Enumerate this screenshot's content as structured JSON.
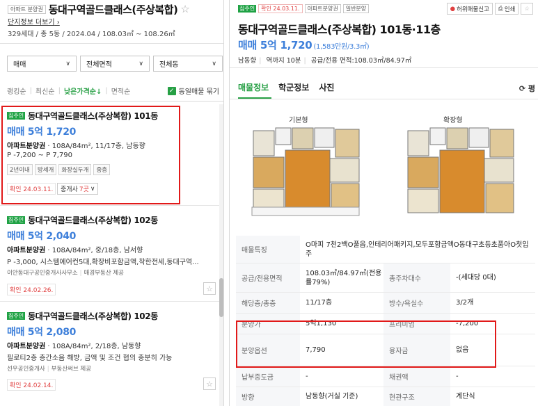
{
  "left": {
    "complex_tag": "아파트 분양권",
    "complex_name": "동대구역골드클래스(주상복합)",
    "more_info": "단지정보 더보기",
    "summary": "329세대 / 총 5동 / 2024.04 / 108.03㎡ ~ 108.26㎡",
    "filters": [
      "매매",
      "전체면적",
      "전체동"
    ],
    "sort": {
      "items": [
        "랭킹순",
        "최신순",
        "낮은가격순↓",
        "면적순"
      ],
      "active_index": 2,
      "same_listing": "동일매물 묶기"
    },
    "listings": [
      {
        "badge": "집주인",
        "title": "동대구역골드클래스(주상복합) 101동",
        "price": "매매 5억 1,720",
        "spec_bold": "아파트분양권",
        "spec_rest": " · 108A/84m², 11/17층, 남동향",
        "desc": "P -7,200 ~ P 7,790",
        "tags": [
          "2년이내",
          "방세개",
          "화장실두개",
          "중층"
        ],
        "agent": "",
        "agent_b": "",
        "confirm": "확인 24.03.11.",
        "agent_count_prefix": "중개사",
        "agent_count": "7곳"
      },
      {
        "badge": "집주인",
        "title": "동대구역골드클래스(주상복합) 102동",
        "price": "매매 5억 2,040",
        "spec_bold": "아파트분양권",
        "spec_rest": " · 108A/84m², 중/18층, 남서향",
        "desc": "P -3,000, 시스템에어컨5대,확장비포함금액,착한전세,동대구역...",
        "tags": [],
        "agent": "이안동대구공인중개사사무소",
        "agent_b": "매경부동산 제공",
        "confirm": "확인 24.02.26.",
        "agent_count_prefix": "",
        "agent_count": ""
      },
      {
        "badge": "집주인",
        "title": "동대구역골드클래스(주상복합) 102동",
        "price": "매매 5억 2,080",
        "spec_bold": "아파트분양권",
        "spec_rest": " · 108A/84m², 2/18층, 남동향",
        "desc": "필로티2층 층간소음 해방, 금액 및 조건 협의 충분히 가능",
        "tags": [],
        "agent": "선우공인중개사",
        "agent_b": "부동산써브 제공",
        "confirm": "확인 24.02.14.",
        "agent_count_prefix": "",
        "agent_count": ""
      }
    ]
  },
  "right": {
    "tags": [
      "집주인",
      "확인 24.03.11.",
      "아파트분양권",
      "일반분양"
    ],
    "actions": {
      "report": "허위매물신고",
      "print": "인쇄"
    },
    "title": "동대구역골드클래스(주상복합) 101동·11층",
    "price": "매매 5억 1,720",
    "price_unit": "(1,583만원/3.3㎡)",
    "info": [
      "남동향",
      "역까지 10분",
      "공급/전용 면적:108.03㎡/84.97㎡"
    ],
    "tabs": [
      "매물정보",
      "학군정보",
      "사진"
    ],
    "refresh": "⟳ 평",
    "plans": {
      "basic": "기본형",
      "extended": "확장형"
    },
    "table": [
      {
        "h1": "매물특징",
        "v1": "O마피 7천2백O풀옵,인테리어패키지,모두포함금액O동대구초등초품아O첫입주",
        "h2": "",
        "v2": ""
      },
      {
        "h1": "공급/전용면적",
        "v1": "108.03㎡/84.97㎡(전용률79%)",
        "h2": "총주차대수",
        "v2": "-(세대당 0대)"
      },
      {
        "h1": "해당층/총층",
        "v1": "11/17층",
        "h2": "방수/욕실수",
        "v2": "3/2개"
      },
      {
        "h1": "분양가",
        "v1": "5억1,130",
        "h2": "프리미엄",
        "v2": "-7,200"
      },
      {
        "h1": "분양옵션",
        "v1": "7,790",
        "h2": "융자금",
        "v2": "없음"
      },
      {
        "h1": "납부중도금",
        "v1": "-",
        "h2": "채권액",
        "v2": "-"
      },
      {
        "h1": "방향",
        "v1": "남동향(거실 기준)",
        "h2": "현관구조",
        "v2": "계단식"
      }
    ]
  },
  "colors": {
    "accent_green": "#27a045",
    "price_blue": "#3d7fda",
    "highlight_red": "#e11919"
  }
}
